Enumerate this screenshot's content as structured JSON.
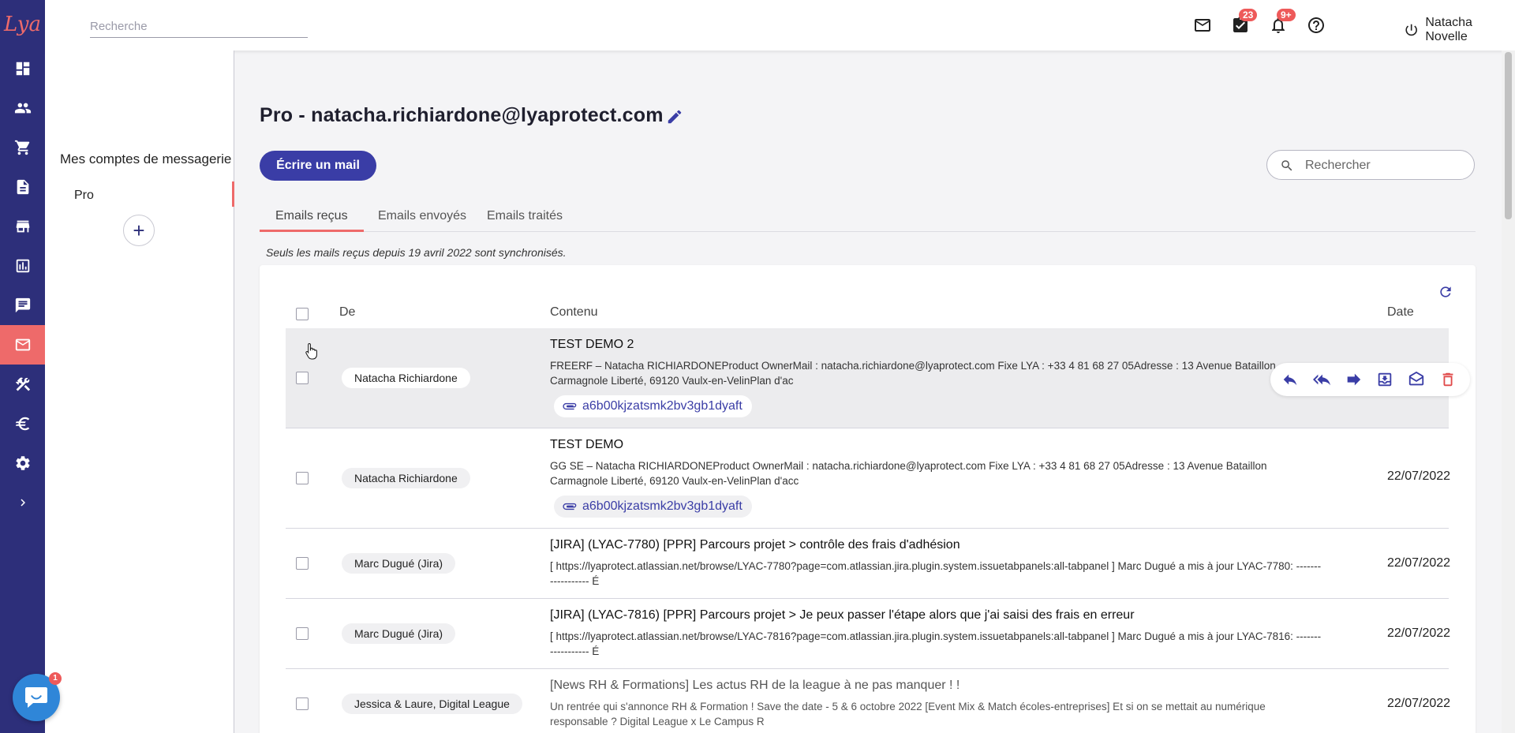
{
  "app": {
    "logo_text": "Lya"
  },
  "header": {
    "search_placeholder": "Recherche",
    "tasks_badge": "23",
    "notifications_badge": "9+",
    "user_name": "Natacha Novelle"
  },
  "rail": {
    "items": [
      "dashboard-icon",
      "contacts-icon",
      "cart-icon",
      "document-icon",
      "store-icon",
      "stats-icon",
      "chat-icon",
      "mail-icon",
      "tools-icon",
      "euro-icon",
      "gear-icon",
      "chevron-right-icon"
    ],
    "active": "mail-icon"
  },
  "accounts": {
    "title": "Mes comptes de messagerie",
    "items": [
      {
        "label": "Pro"
      }
    ],
    "add_label": "+"
  },
  "main": {
    "title": "Pro - natacha.richiardone@lyaprotect.com",
    "compose_label": "Écrire un mail",
    "search_placeholder": "Rechercher",
    "tabs": [
      {
        "label": "Emails reçus",
        "active": true
      },
      {
        "label": "Emails envoyés",
        "active": false
      },
      {
        "label": "Emails traités",
        "active": false
      }
    ],
    "sync_note": "Seuls les mails reçus depuis 19 avril 2022 sont synchronisés.",
    "columns": {
      "from": "De",
      "content": "Contenu",
      "date": "Date"
    }
  },
  "emails": [
    {
      "sender": "Natacha Richiardone",
      "subject": "TEST DEMO 2",
      "excerpt": "FREERF – Natacha RICHIARDONEProduct OwnerMail : natacha.richiardone@lyaprotect.com Fixe LYA : +33 4 81 68 27 05Adresse : 13 Avenue Bataillon Carmagnole Liberté, 69120 Vaulx-en-VelinPlan d'ac",
      "attachment": "a6b00kjzatsmk2bv3gb1dyaft",
      "date": ""
    },
    {
      "sender": "Natacha Richiardone",
      "subject": "TEST DEMO",
      "excerpt": "GG SE – Natacha RICHIARDONEProduct OwnerMail : natacha.richiardone@lyaprotect.com Fixe LYA : +33 4 81 68 27 05Adresse : 13 Avenue Bataillon Carmagnole Liberté, 69120 Vaulx-en-VelinPlan d'acc",
      "attachment": "a6b00kjzatsmk2bv3gb1dyaft",
      "date": "22/07/2022"
    },
    {
      "sender": "Marc Dugué (Jira)",
      "subject": "[JIRA] (LYAC-7780) [PPR] Parcours projet > contrôle des frais d'adhésion",
      "excerpt": "[ https://lyaprotect.atlassian.net/browse/LYAC-7780?page=com.atlassian.jira.plugin.system.issuetabpanels:all-tabpanel ] Marc Dugué a mis à jour LYAC-7780: ------------------ É",
      "date": "22/07/2022"
    },
    {
      "sender": "Marc Dugué (Jira)",
      "subject": "[JIRA] (LYAC-7816) [PPR] Parcours projet > Je peux passer l'étape alors que j'ai saisi des frais en erreur",
      "excerpt": "[ https://lyaprotect.atlassian.net/browse/LYAC-7816?page=com.atlassian.jira.plugin.system.issuetabpanels:all-tabpanel ] Marc Dugué a mis à jour LYAC-7816: ------------------ É",
      "date": "22/07/2022"
    },
    {
      "sender": "Jessica & Laure, Digital League",
      "subject": "[News RH & Formations] Les actus RH de la league à ne pas manquer ! !",
      "excerpt": "Un rentrée qui s'annonce RH & Formation ! Save the date - 5 & 6 octobre 2022 [Event Mix & Match écoles-entreprises] Et si on se mettait au numérique responsable ? Digital League x Le Campus R",
      "date": "22/07/2022"
    }
  ],
  "row_actions": [
    "reply-icon",
    "reply-all-icon",
    "forward-icon",
    "archive-icon",
    "mark-read-icon",
    "delete-icon"
  ],
  "chat_widget": {
    "badge": "1"
  }
}
